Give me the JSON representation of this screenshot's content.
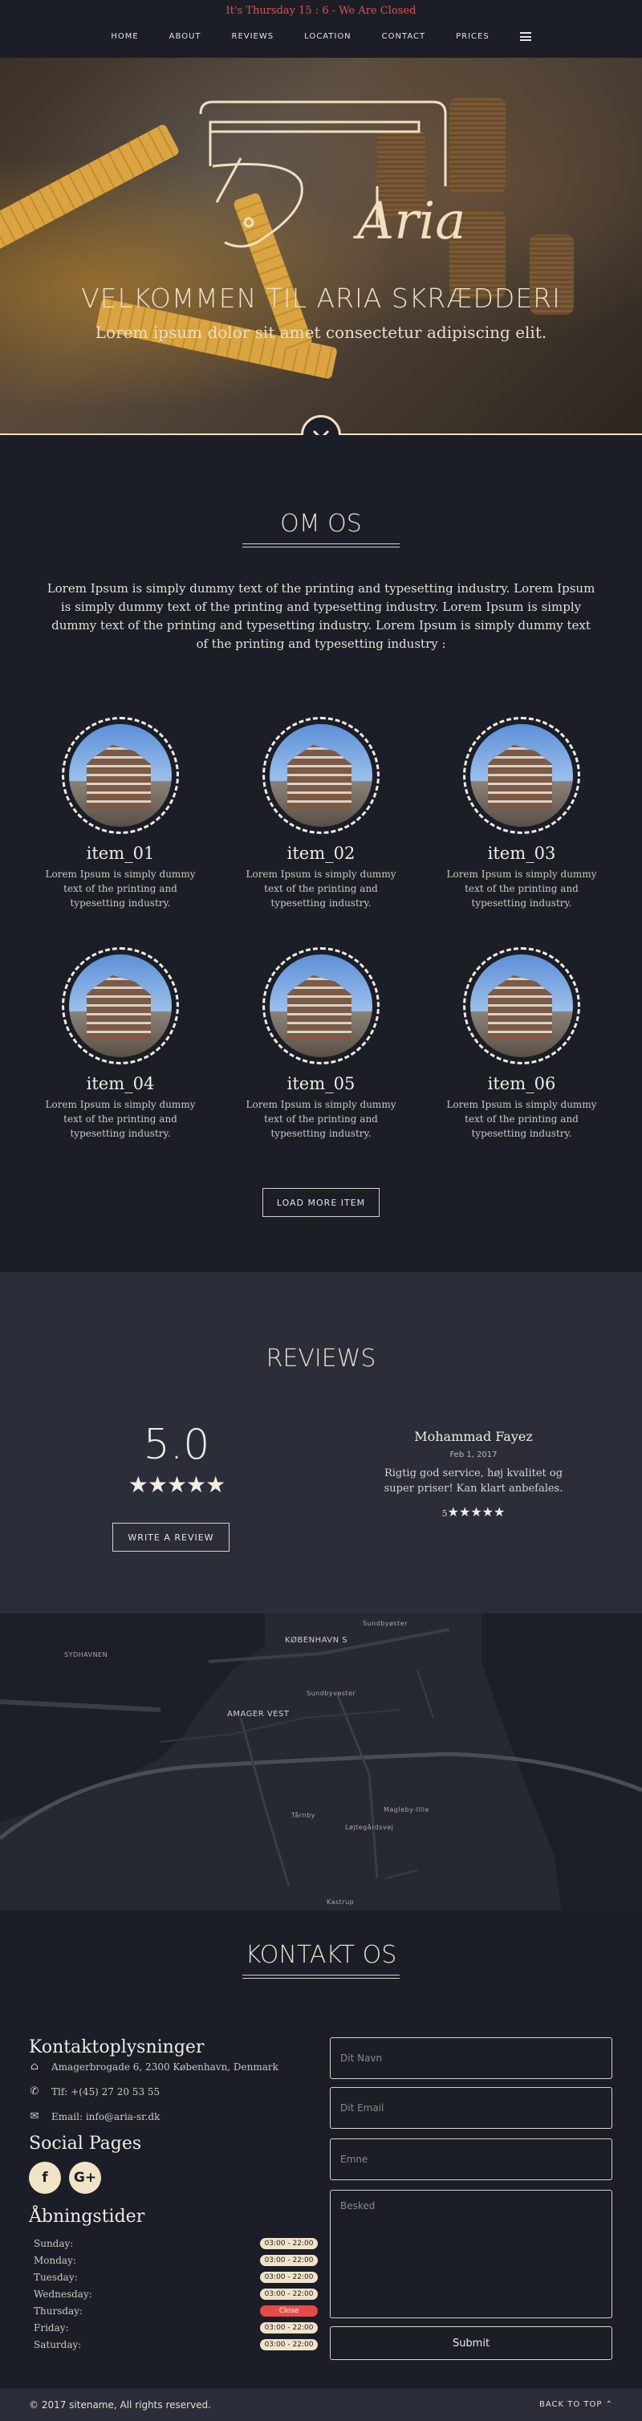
{
  "notice": "It's Thursday 15 : 6 - We Are Closed",
  "nav": {
    "items": [
      "HOME",
      "ABOUT",
      "REVIEWS",
      "LOCATION",
      "CONTACT",
      "PRICES"
    ]
  },
  "hero": {
    "logo_text": "Aria",
    "title": "VELKOMMEN TIL ARIA SKRÆDDERI",
    "subtitle": "Lorem ipsum dolor sit amet consectetur adipiscing elit."
  },
  "about": {
    "title": "OM OS",
    "text": "Lorem Ipsum is simply dummy text of the printing and typesetting industry. Lorem Ipsum is simply dummy text of the printing and typesetting industry. Lorem Ipsum is simply dummy text of the printing and typesetting industry. Lorem Ipsum is simply dummy text of the printing and typesetting industry :",
    "items": [
      {
        "name": "item_01",
        "desc": "Lorem Ipsum is simply dummy text of the printing and typesetting industry."
      },
      {
        "name": "item_02",
        "desc": "Lorem Ipsum is simply dummy text of the printing and typesetting industry."
      },
      {
        "name": "item_03",
        "desc": "Lorem Ipsum is simply dummy text of the printing and typesetting industry."
      },
      {
        "name": "item_04",
        "desc": "Lorem Ipsum is simply dummy text of the printing and typesetting industry."
      },
      {
        "name": "item_05",
        "desc": "Lorem Ipsum is simply dummy text of the printing and typesetting industry."
      },
      {
        "name": "item_06",
        "desc": "Lorem Ipsum is simply dummy text of the printing and typesetting industry."
      }
    ],
    "load_more": "LOAD MORE ITEM"
  },
  "reviews": {
    "title": "REVIEWS",
    "score": "5.0",
    "stars": "★★★★★",
    "write_button": "WRITE A REVIEW",
    "review": {
      "name": "Mohammad Fayez",
      "date": "Feb 1, 2017",
      "text": "Rigtig god service, høj kvalitet og super priser! Kan klart anbefales.",
      "rating": "5",
      "stars": "★★★★★"
    }
  },
  "map": {
    "labels": [
      "KØBENHAVN S",
      "AMAGER VEST",
      "SYDHAVNEN"
    ],
    "small_labels": [
      "Sundbyvester",
      "Sundbyøster",
      "Tårnby",
      "Magleby-lille",
      "Kastrup",
      "Løjtegårdsvej"
    ]
  },
  "contact": {
    "title": "KONTAKT OS",
    "info_heading": "Kontaktoplysninger",
    "address": "Amagerbrogade 6, 2300 København, Denmark",
    "phone": "Tlf: +(45) 27 20 53 55",
    "email": "Email: info@aria-sr.dk",
    "social_heading": "Social Pages",
    "social": [
      "f",
      "G+"
    ],
    "hours_heading": "Åbningstider",
    "hours": [
      {
        "day": "Sunday:",
        "time": "03:00 - 22:00",
        "closed": false
      },
      {
        "day": "Monday:",
        "time": "03:00 - 22:00",
        "closed": false
      },
      {
        "day": "Tuesday:",
        "time": "03:00 - 22:00",
        "closed": false
      },
      {
        "day": "Wednesday:",
        "time": "03:00 - 22:00",
        "closed": false
      },
      {
        "day": "Thursday:",
        "time": "Close",
        "closed": true
      },
      {
        "day": "Friday:",
        "time": "03:00 - 22:00",
        "closed": false
      },
      {
        "day": "Saturday:",
        "time": "03:00 - 22:00",
        "closed": false
      }
    ],
    "form": {
      "name_placeholder": "Dit Navn",
      "email_placeholder": "Dit Email",
      "subject_placeholder": "Emne",
      "message_placeholder": "Besked",
      "submit": "Submit"
    }
  },
  "footer": {
    "copyright": "© 2017 sitename, All rights reserved.",
    "back_to_top": "BACK TO TOP ⌃"
  },
  "colors": {
    "background": "#1b1e27",
    "reviews_bg": "#2b2e39",
    "accent_cream": "#f1e3c8",
    "notice_red": "#e0524e",
    "closed_red": "#e84a4a"
  }
}
